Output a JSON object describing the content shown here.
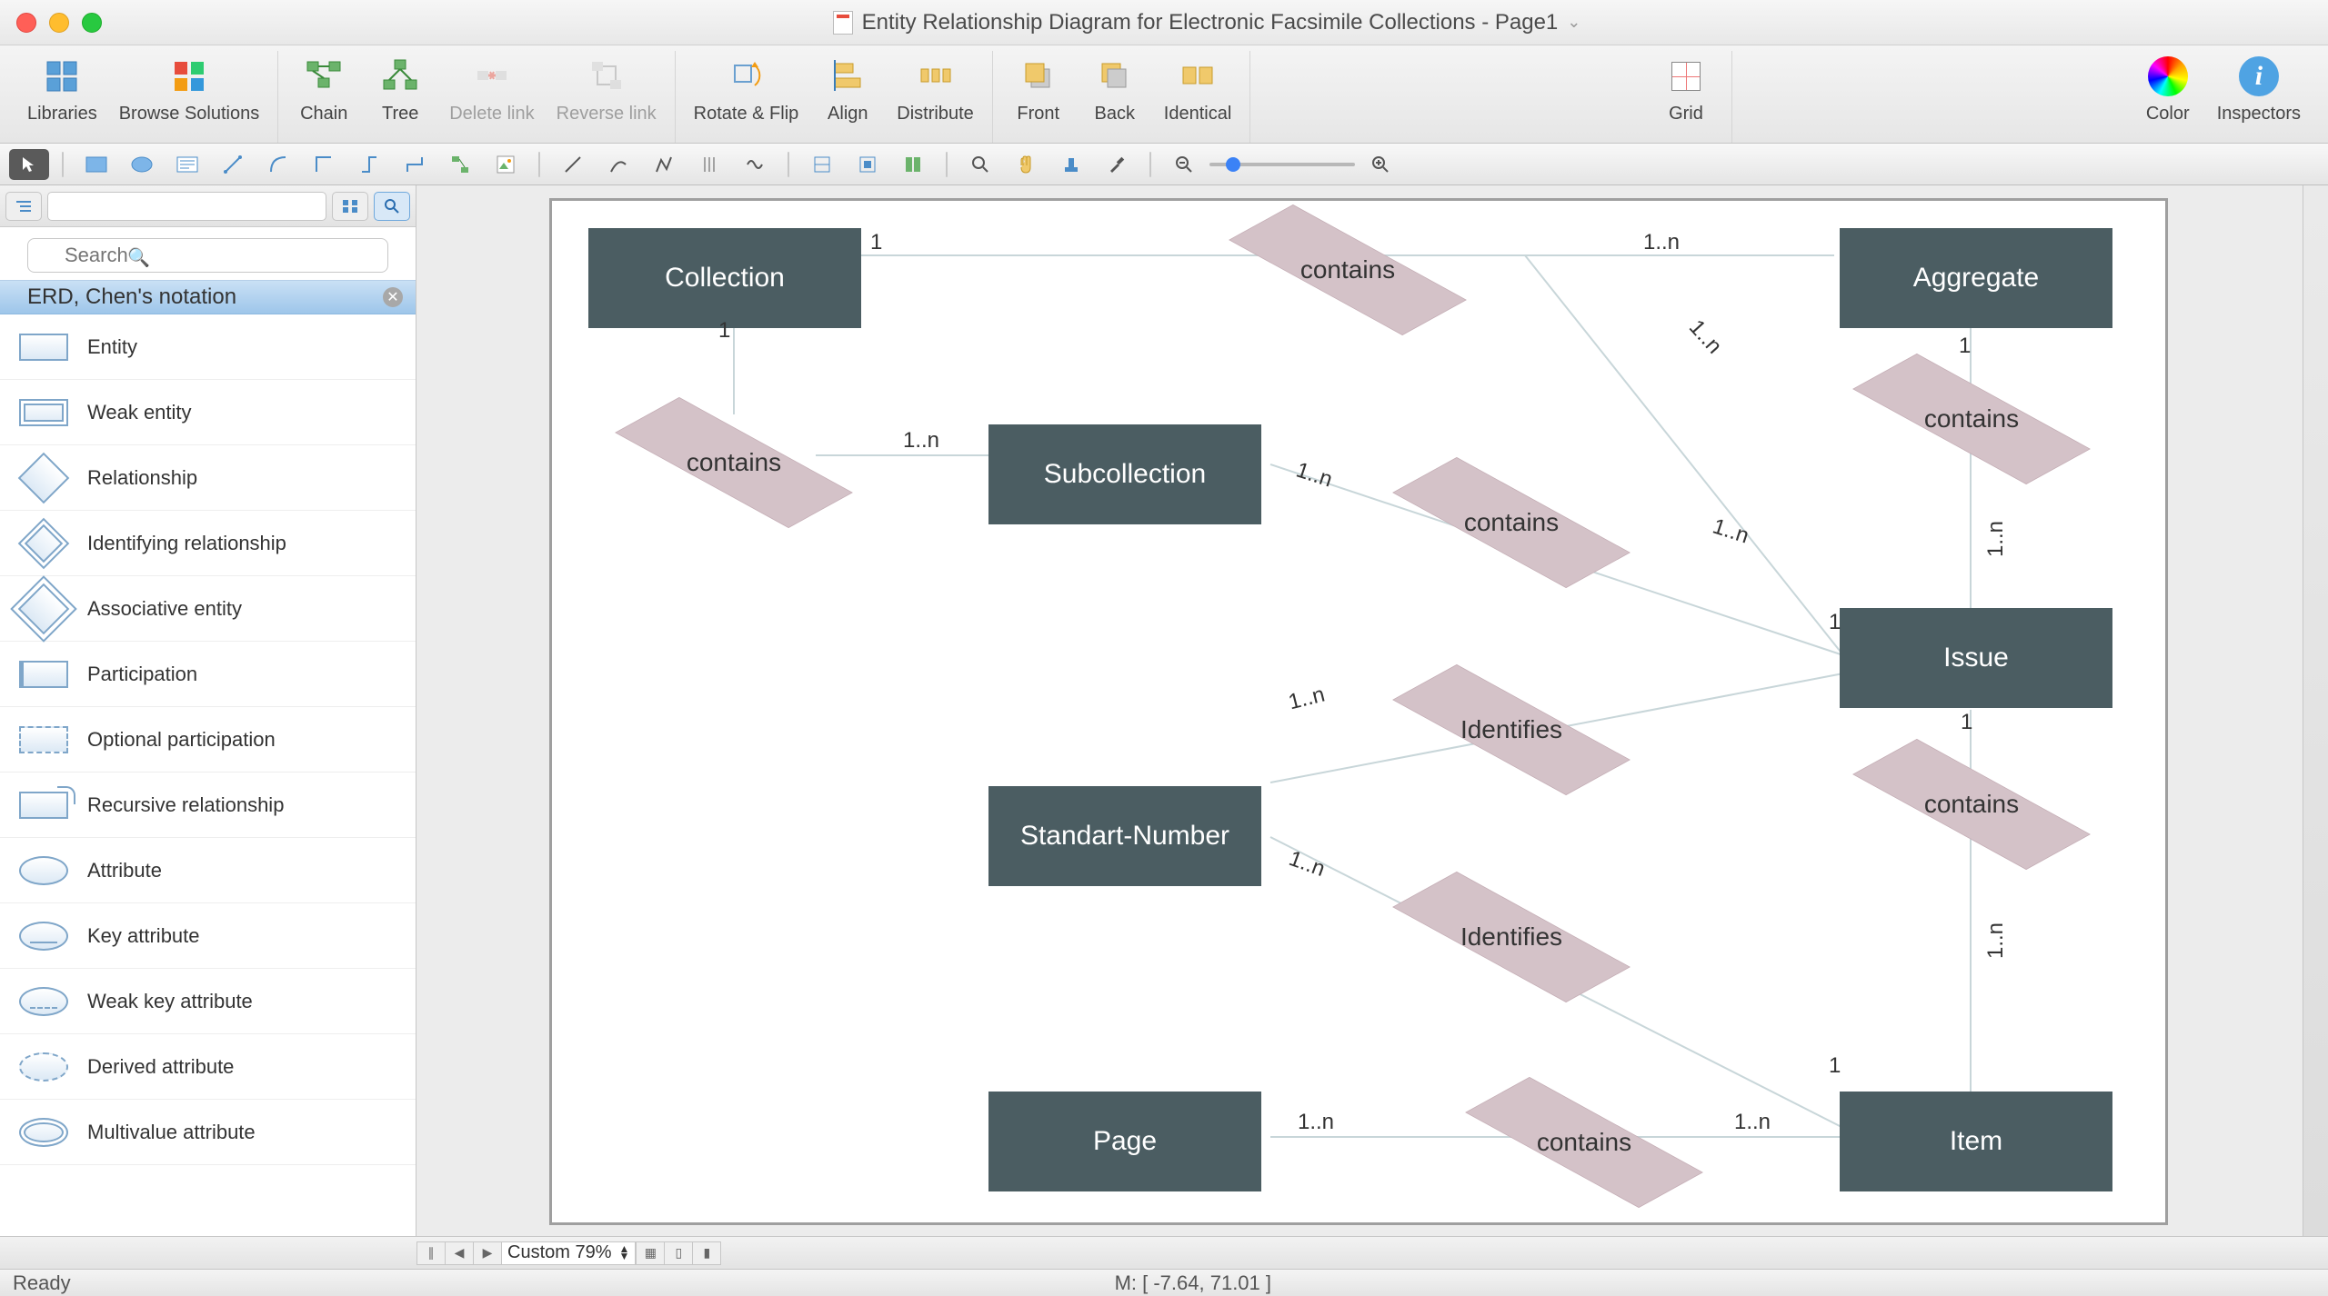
{
  "window": {
    "title": "Entity Relationship Diagram for Electronic Facsimile Collections - Page1"
  },
  "toolbar": {
    "libraries": "Libraries",
    "browse": "Browse Solutions",
    "chain": "Chain",
    "tree": "Tree",
    "delete_link": "Delete link",
    "reverse_link": "Reverse link",
    "rotate_flip": "Rotate & Flip",
    "align": "Align",
    "distribute": "Distribute",
    "front": "Front",
    "back": "Back",
    "identical": "Identical",
    "grid": "Grid",
    "color": "Color",
    "inspectors": "Inspectors"
  },
  "search": {
    "placeholder": "Search"
  },
  "library": {
    "header": "ERD, Chen's notation",
    "items": [
      "Entity",
      "Weak entity",
      "Relationship",
      "Identifying relationship",
      "Associative entity",
      "Participation",
      "Optional participation",
      "Recursive relationship",
      "Attribute",
      "Key attribute",
      "Weak key attribute",
      "Derived attribute",
      "Multivalue attribute"
    ]
  },
  "diagram": {
    "entities": {
      "collection": "Collection",
      "aggregate": "Aggregate",
      "subcollection": "Subcollection",
      "issue": "Issue",
      "standart_number": "Standart-Number",
      "page": "Page",
      "item": "Item"
    },
    "relationships": {
      "contains": "contains",
      "identifies": "Identifies"
    },
    "cardinality": {
      "one": "1",
      "one_n": "1..n"
    }
  },
  "bottom": {
    "zoom_label": "Custom 79%"
  },
  "status": {
    "ready": "Ready",
    "mouse": "M: [ -7.64, 71.01 ]"
  }
}
